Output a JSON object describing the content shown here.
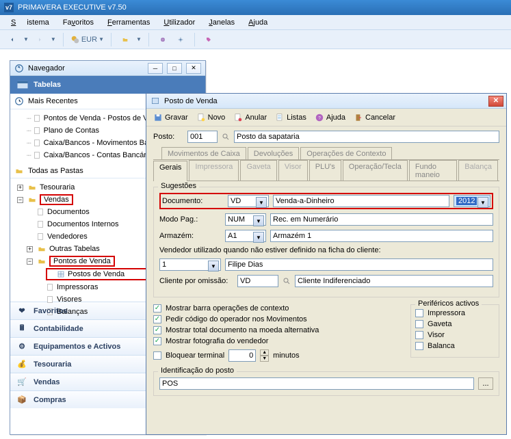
{
  "app": {
    "title": "PRIMAVERA EXECUTIVE v7.50"
  },
  "menubar": {
    "sistema": "Sistema",
    "favoritos": "Favoritos",
    "ferramentas": "Ferramentas",
    "utilizador": "Utilizador",
    "janelas": "Janelas",
    "ajuda": "Ajuda"
  },
  "toolbar": {
    "currency": "EUR"
  },
  "navegador": {
    "window_title": "Navegador",
    "heading": "Tabelas",
    "recents_label": "Mais Recentes",
    "recents": [
      "Pontos de Venda - Postos de Ve",
      "Plano de Contas",
      "Caixa/Bancos - Movimentos Ban",
      "Caixa/Bancos - Contas Bancária"
    ],
    "all_folders_label": "Todas as Pastas",
    "tree": {
      "tesouraria": "Tesouraria",
      "vendas": "Vendas",
      "vendas_children": {
        "documentos": "Documentos",
        "documentos_internos": "Documentos Internos",
        "vendedores": "Vendedores",
        "outras_tabelas": "Outras Tabelas",
        "pontos_venda": "Pontos de Venda",
        "pv_children": {
          "postos": "Postos de Venda",
          "impressoras": "Impressoras",
          "visores": "Visores",
          "balancas": "Balanças"
        }
      }
    },
    "bars": {
      "favoritos": "Favoritos",
      "contabilidade": "Contabilidade",
      "equipamentos": "Equipamentos e Activos",
      "tesouraria": "Tesouraria",
      "vendas": "Vendas",
      "compras": "Compras"
    }
  },
  "posto": {
    "title": "Posto de Venda",
    "toolbar": {
      "gravar": "Gravar",
      "novo": "Novo",
      "anular": "Anular",
      "listas": "Listas",
      "ajuda": "Ajuda",
      "cancelar": "Cancelar"
    },
    "posto_label": "Posto:",
    "posto_code": "001",
    "posto_name": "Posto da sapataria",
    "tabs_top": {
      "mov_caixa": "Movimentos de Caixa",
      "devolucoes": "Devoluções",
      "oper_contexto": "Operações de Contexto"
    },
    "tabs_bottom": {
      "gerais": "Gerais",
      "impressora": "Impressora",
      "gaveta": "Gaveta",
      "visor": "Visor",
      "plus": "PLU's",
      "oper_tecla": "Operação/Tecla",
      "fundo": "Fundo maneio",
      "balanca": "Balança"
    },
    "sugestoes_label": "Sugestões",
    "documento_label": "Documento:",
    "documento_code": "VD",
    "documento_name": "Venda-a-Dinheiro",
    "documento_year": "2012",
    "modopag_label": "Modo Pag.:",
    "modopag_code": "NUM",
    "modopag_name": "Rec. em Numerário",
    "armazem_label": "Armazém:",
    "armazem_code": "A1",
    "armazem_name": "Armazém 1",
    "vendedor_hint": "Vendedor utilizado quando não estiver definido na ficha do cliente:",
    "vendedor_code": "1",
    "vendedor_name": "Filipe Dias",
    "cliente_label": "Cliente por omissão:",
    "cliente_code": "VD",
    "cliente_name": "Cliente Indiferenciado",
    "checks": {
      "barra": "Mostrar barra operações de contexto",
      "codigo": "Pedir código do operador nos Movimentos",
      "total": "Mostrar total documento na moeda alternativa",
      "foto": "Mostrar fotografia do vendedor",
      "bloquear": "Bloquear terminal"
    },
    "minutos_value": "0",
    "minutos_label": "minutos",
    "perifericos_label": "Periféricos activos",
    "perifericos": {
      "impressora": "Impressora",
      "gaveta": "Gaveta",
      "visor": "Visor",
      "balanca": "Balanca"
    },
    "ident_label": "Identificação do posto",
    "ident_value": "POS",
    "browse": "..."
  }
}
